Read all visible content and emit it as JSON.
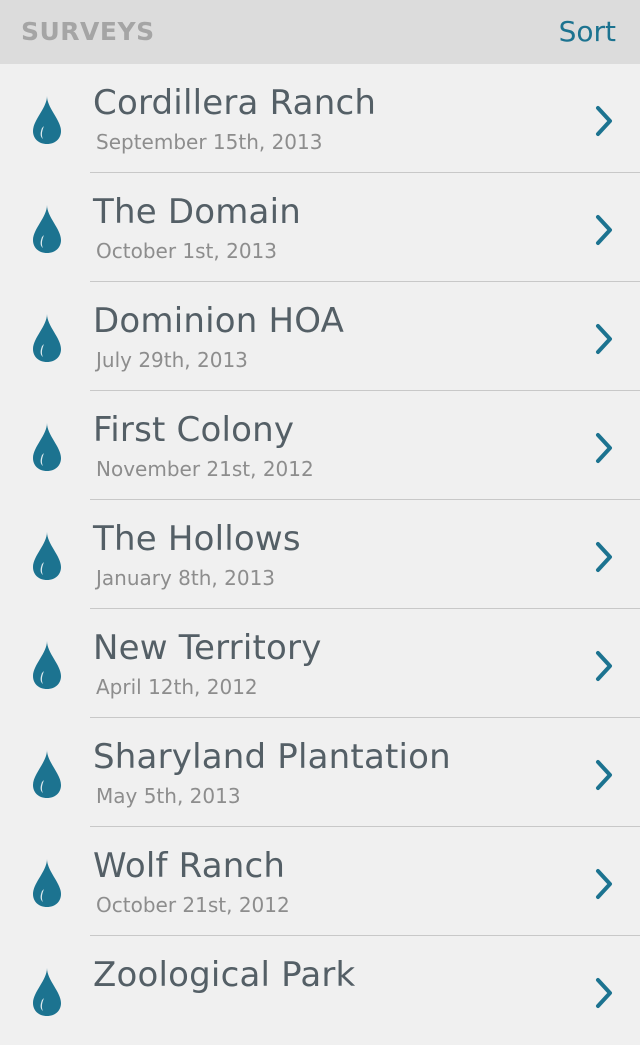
{
  "header": {
    "title": "SURVEYS",
    "sort_label": "Sort"
  },
  "colors": {
    "accent": "#1c7390",
    "header_bg": "#dcdcdc",
    "background": "#f0f0f0"
  },
  "list_icon": "water-drop-icon",
  "row_icon": "chevron-right-icon",
  "surveys": [
    {
      "name": "Cordillera Ranch",
      "date": "September 15th, 2013"
    },
    {
      "name": "The Domain",
      "date": "October 1st, 2013"
    },
    {
      "name": "Dominion HOA",
      "date": "July 29th, 2013"
    },
    {
      "name": "First Colony",
      "date": "November 21st, 2012"
    },
    {
      "name": "The Hollows",
      "date": "January 8th, 2013"
    },
    {
      "name": "New Territory",
      "date": "April 12th, 2012"
    },
    {
      "name": "Sharyland Plantation",
      "date": "May 5th, 2013"
    },
    {
      "name": "Wolf Ranch",
      "date": "October 21st, 2012"
    },
    {
      "name": "Zoological Park",
      "date": ""
    }
  ]
}
